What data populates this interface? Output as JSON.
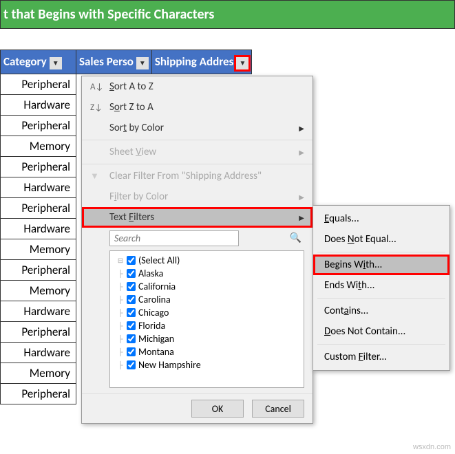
{
  "title": "t that Begins with Specific Characters",
  "headers": {
    "category": "Category",
    "sales": "Sales Perso",
    "shipping": "Shipping Addres"
  },
  "rows": [
    "Peripheral",
    "Hardware",
    "Peripheral",
    "Memory",
    "Peripheral",
    "Hardware",
    "Peripheral",
    "Hardware",
    "Memory",
    "Peripheral",
    "Memory",
    "Hardware",
    "Peripheral",
    "Hardware",
    "Memory",
    "Peripheral"
  ],
  "menu": {
    "sortAZ": "Sort A to Z",
    "sortZA": "Sort Z to A",
    "sortColor": "Sort by Color",
    "sheetView": "Sheet View",
    "clearFilter": "Clear Filter From \"Shipping Address\"",
    "filterColor": "Filter by Color",
    "textFilters": "Text Filters",
    "searchPlaceholder": "Search",
    "ok": "OK",
    "cancel": "Cancel"
  },
  "list": [
    "(Select All)",
    "Alaska",
    "California",
    "Carolina",
    "Chicago",
    "Florida",
    "Michigan",
    "Montana",
    "New Hampshire"
  ],
  "submenu": {
    "equals": "Equals...",
    "notEqual": "Does Not Equal...",
    "begins": "Begins With...",
    "ends": "Ends With...",
    "contains": "Contains...",
    "notContain": "Does Not Contain...",
    "custom": "Custom Filter..."
  },
  "watermark": "wsxdn.com"
}
